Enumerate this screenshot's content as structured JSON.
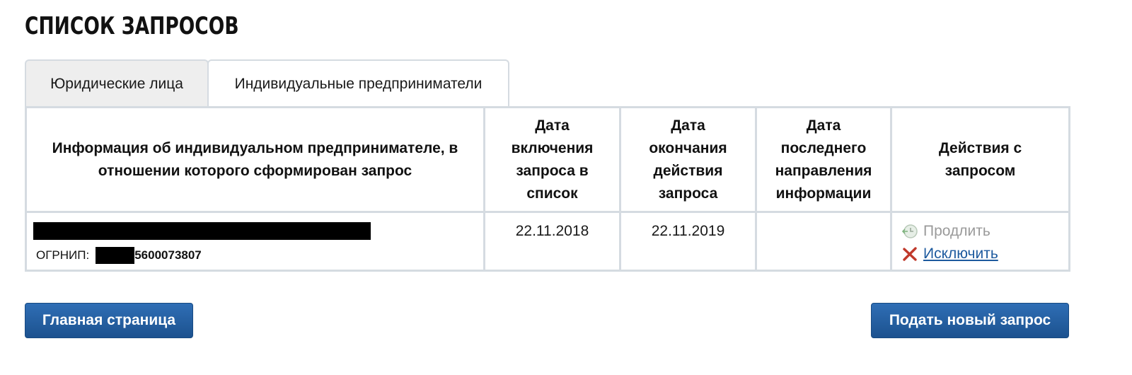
{
  "page": {
    "title": "Список запросов"
  },
  "tabs": [
    {
      "label": "Юридические лица",
      "active": false
    },
    {
      "label": "Индивидуальные предприниматели",
      "active": true
    }
  ],
  "table": {
    "headers": [
      "Информация об индивидуальном предпринимателе, в отношении которого сформирован запрос",
      "Дата включения запроса в список",
      "Дата окончания действия запроса",
      "Дата последнего направления информации",
      "Действия с запросом"
    ],
    "rows": [
      {
        "name": "",
        "ogrnip_label": "ОГРНИП:",
        "ogrnip_visible": "5600073807",
        "date_included": "22.11.2018",
        "date_expiry": "22.11.2019",
        "date_last_sent": "",
        "actions": {
          "extend": {
            "label": "Продлить",
            "icon": "clock-arrow-icon",
            "enabled": false
          },
          "exclude": {
            "label": "Исключить",
            "icon": "close-x-icon",
            "enabled": true
          }
        }
      }
    ]
  },
  "buttons": {
    "home": "Главная страница",
    "new_request": "Подать новый запрос"
  },
  "colors": {
    "button_bg": "#1c528f",
    "link": "#1d5a9e",
    "border": "#d5dbe1",
    "tab_inactive_bg": "#eeeeee",
    "disabled_text": "#9a9a9a",
    "exclude_icon": "#c0392b"
  }
}
